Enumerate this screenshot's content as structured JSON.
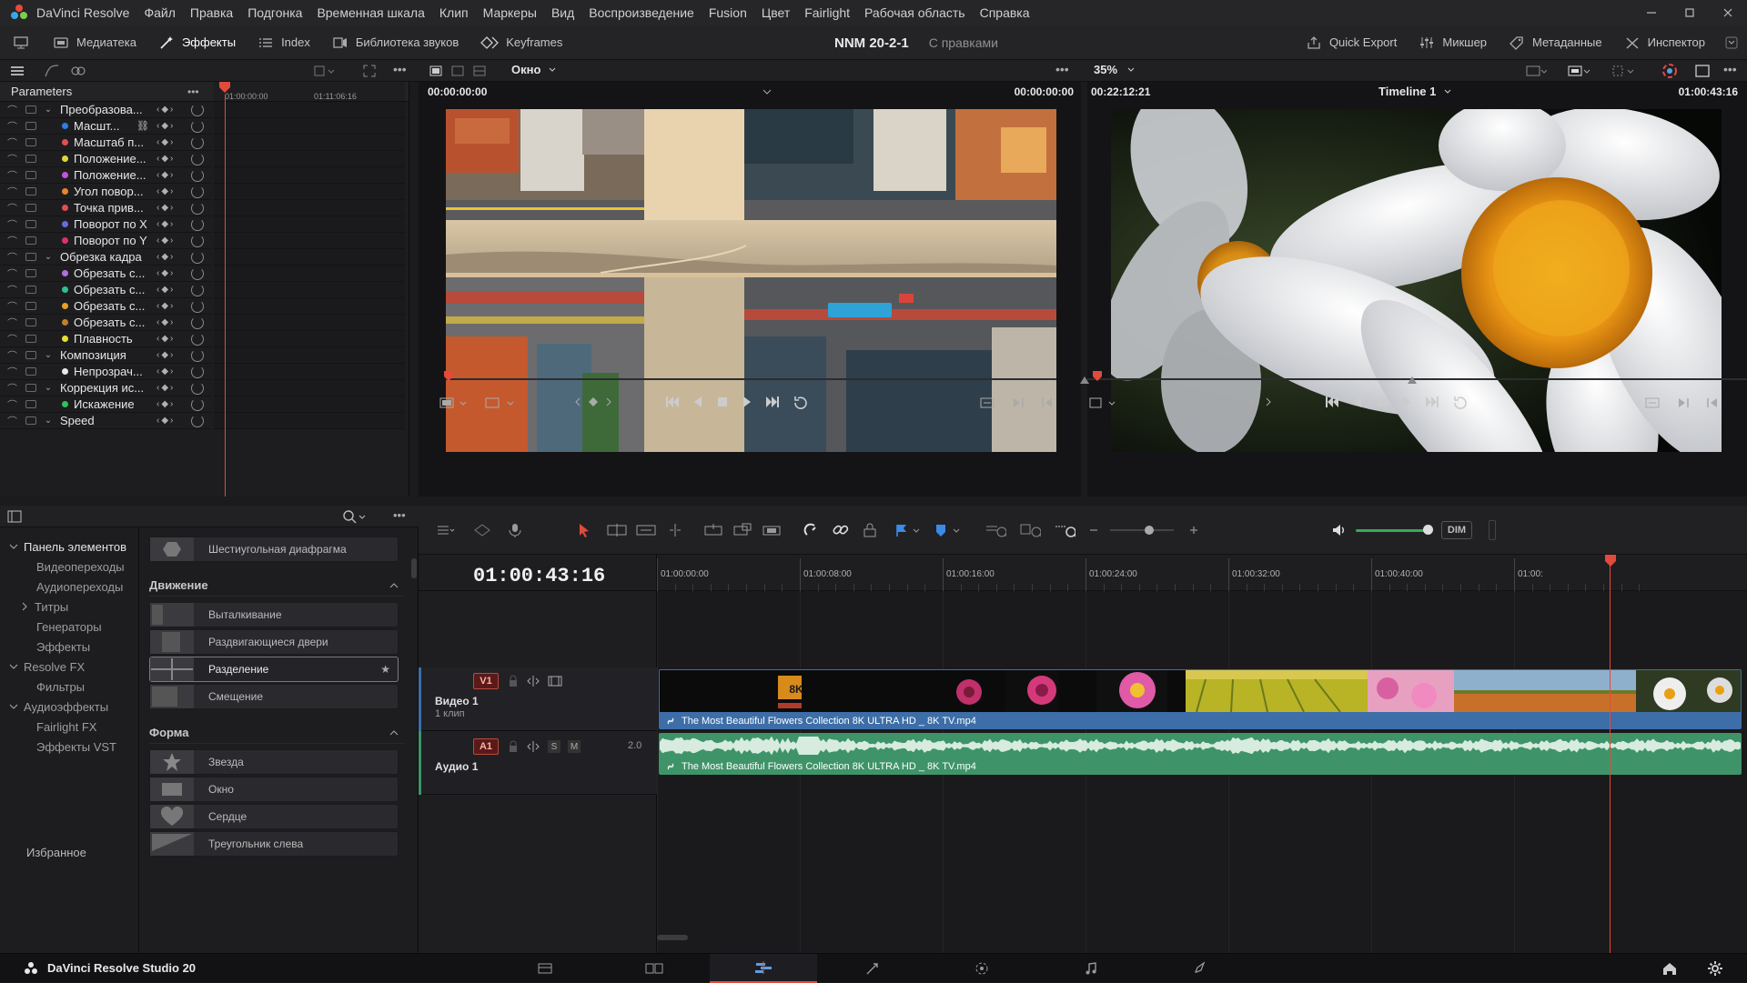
{
  "app": {
    "name": "DaVinci Resolve",
    "menu": [
      "Файл",
      "Правка",
      "Подгонка",
      "Временная шкала",
      "Клип",
      "Маркеры",
      "Вид",
      "Воспроизведение",
      "Fusion",
      "Цвет",
      "Fairlight",
      "Рабочая область",
      "Справка"
    ]
  },
  "toolbar": {
    "media": "Медиатека",
    "effects": "Эффекты",
    "index": "Index",
    "sound_library": "Библиотека звуков",
    "keyframes": "Keyframes",
    "project_name": "NNM 20-2-1",
    "project_state": "С правками",
    "quick_export": "Quick Export",
    "mixer": "Микшер",
    "metadata": "Метаданные",
    "inspector": "Инспектор"
  },
  "viewer_strip": {
    "window_select": "Окно",
    "zoom": "35%"
  },
  "keyframes": {
    "header": "Parameters",
    "ruler": [
      "01:00:00:00",
      "01:11:06:16"
    ],
    "params": [
      {
        "label": "Преобразова...",
        "group": true,
        "color": ""
      },
      {
        "label": "Масшт...",
        "group": false,
        "color": "#2f7de0",
        "link": true
      },
      {
        "label": "Масштаб п...",
        "group": false,
        "color": "#e05050"
      },
      {
        "label": "Положение...",
        "group": false,
        "color": "#d8d83a"
      },
      {
        "label": "Положение...",
        "group": false,
        "color": "#c056d8"
      },
      {
        "label": "Угол повор...",
        "group": false,
        "color": "#e8862a"
      },
      {
        "label": "Точка прив...",
        "group": false,
        "color": "#e05050"
      },
      {
        "label": "Поворот по X",
        "group": false,
        "color": "#6a6ae0"
      },
      {
        "label": "Поворот по Y",
        "group": false,
        "color": "#e0306a"
      },
      {
        "label": "Обрезка кадра",
        "group": true,
        "color": ""
      },
      {
        "label": "Обрезать с...",
        "group": false,
        "color": "#b070e0"
      },
      {
        "label": "Обрезать с...",
        "group": false,
        "color": "#30c090"
      },
      {
        "label": "Обрезать с...",
        "group": false,
        "color": "#e8a020"
      },
      {
        "label": "Обрезать с...",
        "group": false,
        "color": "#c08030"
      },
      {
        "label": "Плавность",
        "group": false,
        "color": "#e8e030"
      },
      {
        "label": "Композиция",
        "group": true,
        "color": ""
      },
      {
        "label": "Непрозрач...",
        "group": false,
        "color": "#e8e8e8"
      },
      {
        "label": "Коррекция ис...",
        "group": true,
        "color": ""
      },
      {
        "label": "Искажение",
        "group": false,
        "color": "#30c060"
      },
      {
        "label": "Speed",
        "group": true,
        "color": ""
      }
    ]
  },
  "source_viewer": {
    "tc_left": "00:00:00:00",
    "tc_right": "00:00:00:00"
  },
  "timeline_viewer": {
    "tc_left": "00:22:12:21",
    "name": "Timeline 1",
    "tc_right": "01:00:43:16"
  },
  "effects_browser": {
    "tree": [
      {
        "label": "Панель элементов",
        "level": 0,
        "expand": "open"
      },
      {
        "label": "Видеопереходы",
        "level": 1,
        "expand": ""
      },
      {
        "label": "Аудиопереходы",
        "level": 1,
        "expand": ""
      },
      {
        "label": "Титры",
        "level": 1,
        "expand": "closed"
      },
      {
        "label": "Генераторы",
        "level": 1,
        "expand": ""
      },
      {
        "label": "Эффекты",
        "level": 1,
        "expand": ""
      },
      {
        "label": "Resolve FX",
        "level": 0.5,
        "expand": "open"
      },
      {
        "label": "Фильтры",
        "level": 1,
        "expand": ""
      },
      {
        "label": "Аудиоэффекты",
        "level": 0.5,
        "expand": "open"
      },
      {
        "label": "Fairlight FX",
        "level": 1,
        "expand": ""
      },
      {
        "label": "Эффекты VST",
        "level": 1,
        "expand": ""
      }
    ],
    "favorites": "Избранное",
    "top_item": "Шестиугольная диафрагма",
    "sections": [
      {
        "title": "Движение",
        "items": [
          "Выталкивание",
          "Раздвигающиеся двери",
          "Разделение",
          "Смещение"
        ]
      },
      {
        "title": "Форма",
        "items": [
          "Звезда",
          "Окно",
          "Сердце",
          "Треугольник слева"
        ]
      }
    ],
    "selected": "Разделение"
  },
  "timeline": {
    "timecode": "01:00:43:16",
    "ruler": [
      "01:00:00:00",
      "01:00:08:00",
      "01:00:16:00",
      "01:00:24:00",
      "01:00:32:00",
      "01:00:40:00",
      "01:00:"
    ],
    "audio_level": "DIM",
    "video_track": {
      "badge": "V1",
      "name": "Видео 1",
      "sub": "1 клип",
      "clip": "The Most Beautiful Flowers Collection 8K ULTRA HD _ 8K TV.mp4"
    },
    "audio_track": {
      "badge": "A1",
      "name": "Аудио 1",
      "gain": "2.0",
      "clip": "The Most Beautiful Flowers Collection 8K ULTRA HD _ 8K TV.mp4",
      "solo": "S",
      "mute": "M"
    },
    "logo_8k": "8K"
  },
  "status": {
    "product": "DaVinci Resolve Studio 20"
  },
  "colors": {
    "accent": "#e24a3b",
    "video_clip": "#3d6ea8",
    "audio_clip": "#3e9468"
  }
}
